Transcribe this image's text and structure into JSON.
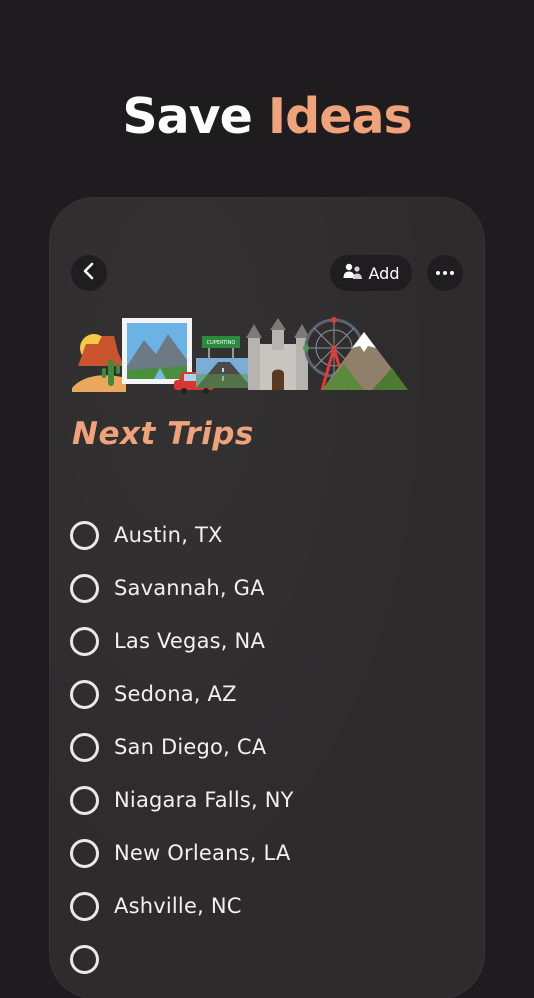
{
  "headline": {
    "part1": "Save",
    "part2": "Ideas"
  },
  "toolbar": {
    "add_label": "Add"
  },
  "list": {
    "title": "Next Trips",
    "items": [
      {
        "label": "Austin, TX"
      },
      {
        "label": "Savannah, GA"
      },
      {
        "label": "Las Vegas, NA"
      },
      {
        "label": "Sedona, AZ"
      },
      {
        "label": "San Diego, CA"
      },
      {
        "label": "Niagara Falls, NY"
      },
      {
        "label": "New Orleans, LA"
      },
      {
        "label": "Ashville, NC"
      }
    ]
  },
  "header_image": {
    "icons": [
      "desert-icon",
      "national-park-icon",
      "car-icon",
      "motorway-icon",
      "castle-icon",
      "ferris-wheel-icon",
      "mountain-icon"
    ],
    "highway_sign_text": "CUPERTINO"
  },
  "colors": {
    "accent": "#f0a37a",
    "background": "#1e1c1f",
    "card": "#2d2b2c",
    "button": "#1f1d1f"
  }
}
